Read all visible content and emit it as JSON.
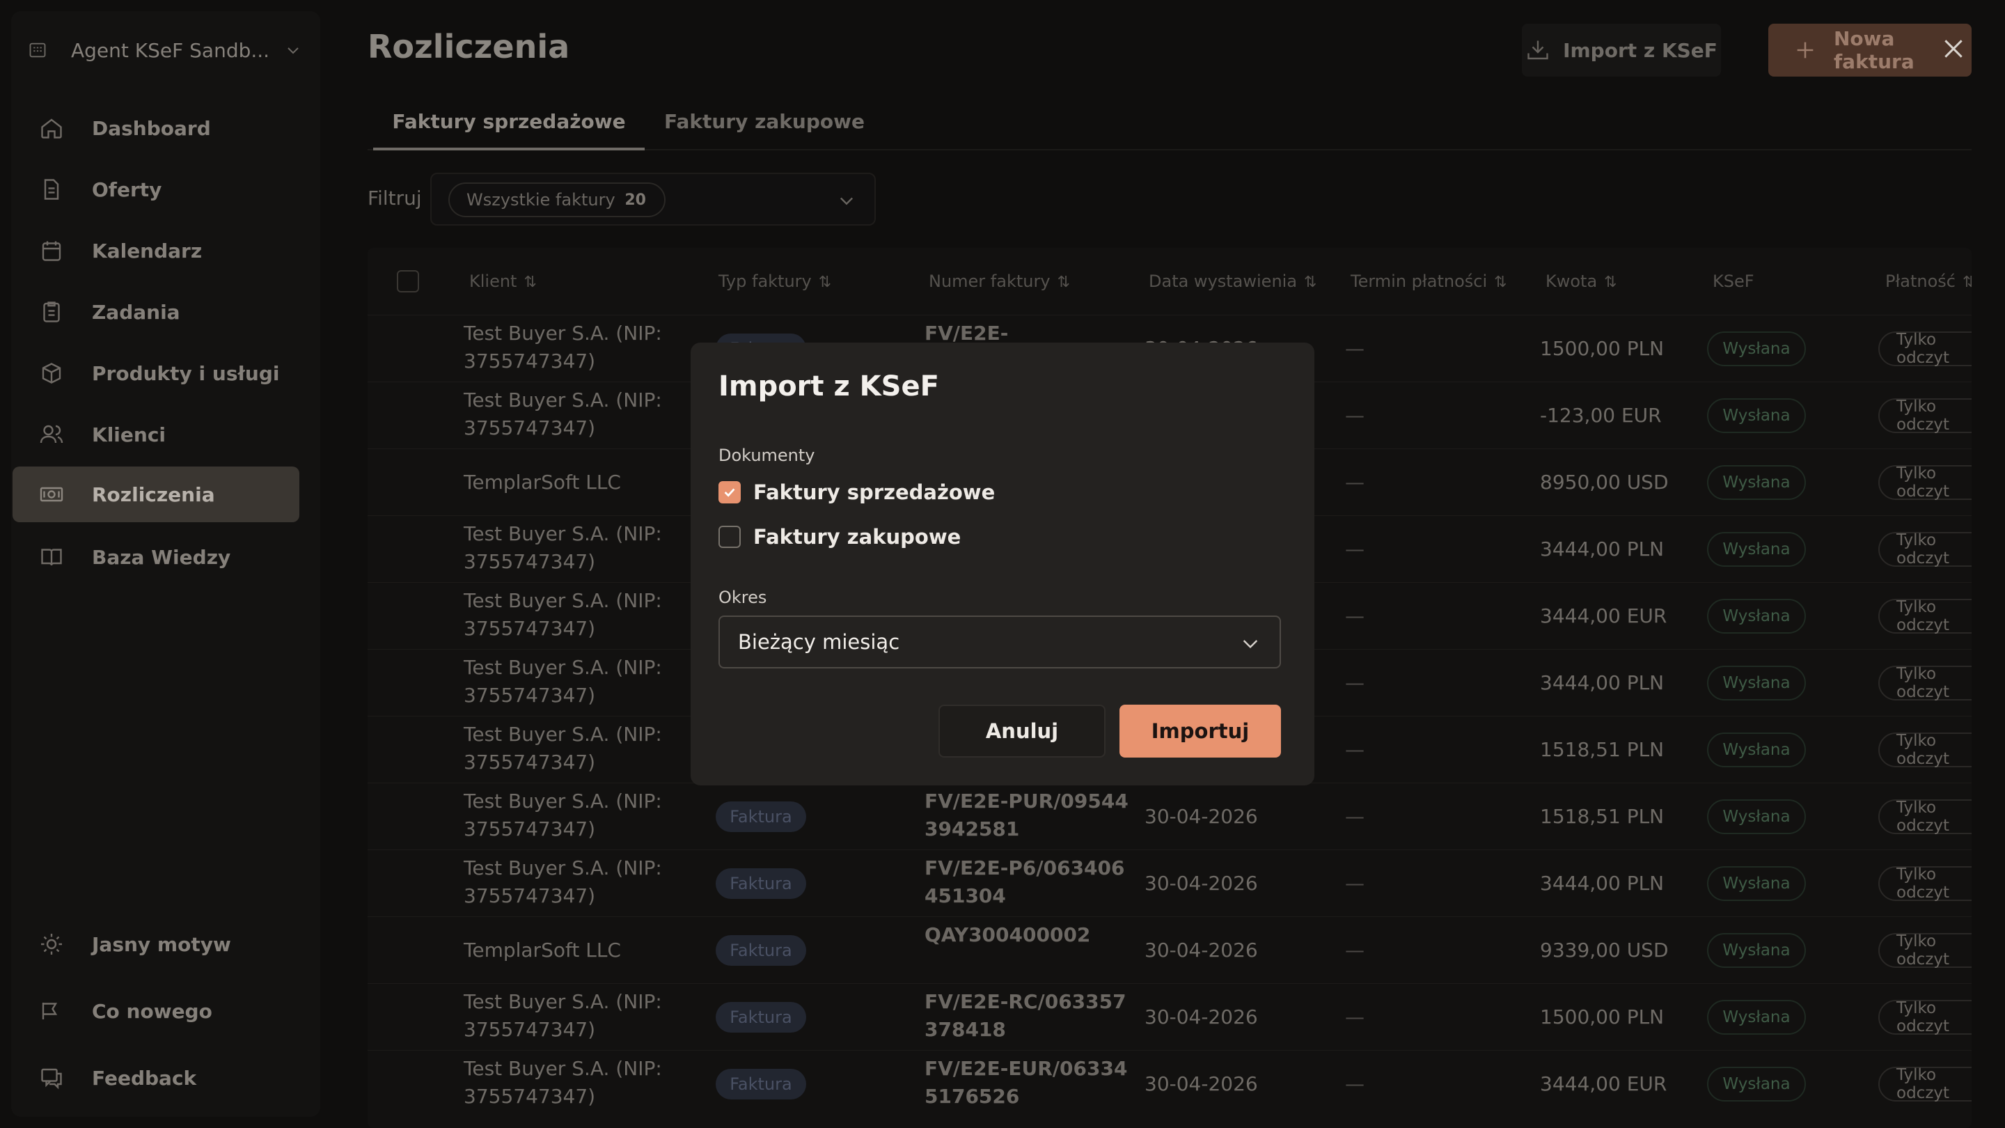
{
  "app": {
    "workspace": "Agent KSeF Sandb...",
    "page_title": "Rozliczenia"
  },
  "sidebar": {
    "items": [
      {
        "label": "Dashboard",
        "icon": "home-icon"
      },
      {
        "label": "Oferty",
        "icon": "document-icon"
      },
      {
        "label": "Kalendarz",
        "icon": "calendar-icon"
      },
      {
        "label": "Zadania",
        "icon": "clipboard-icon"
      },
      {
        "label": "Produkty i usługi",
        "icon": "box-icon"
      },
      {
        "label": "Klienci",
        "icon": "users-icon"
      },
      {
        "label": "Rozliczenia",
        "icon": "money-icon",
        "active": true
      },
      {
        "label": "Baza Wiedzy",
        "icon": "book-icon"
      }
    ],
    "bottom": [
      {
        "label": "Jasny motyw",
        "icon": "sun-icon"
      },
      {
        "label": "Co nowego",
        "icon": "megaphone-icon"
      },
      {
        "label": "Feedback",
        "icon": "feedback-icon"
      }
    ]
  },
  "header": {
    "import_label": "Import z KSeF",
    "new_label": "Nowa faktura"
  },
  "tabs": [
    "Faktury sprzedażowe",
    "Faktury zakupowe"
  ],
  "filter": {
    "label": "Filtruj",
    "chip_label": "Wszystkie faktury",
    "chip_count": "20"
  },
  "table": {
    "columns": [
      "Klient",
      "Typ faktury",
      "Numer faktury",
      "Data wystawienia",
      "Termin płatności",
      "Kwota",
      "KSeF",
      "Płatność"
    ],
    "rows": [
      {
        "client": "Test Buyer S.A. (NIP: 3755747347)",
        "type": "Faktura",
        "number": "FV/E2E-",
        "date": "30-04-2026",
        "term": "—",
        "amount": "1500,00 PLN",
        "ksef": "Wysłana",
        "payment": "Tylko odczyt"
      },
      {
        "client": "Test Buyer S.A. (NIP: 3755747347)",
        "type": "",
        "number": "",
        "date": "",
        "term": "—",
        "amount": "-123,00 EUR",
        "ksef": "Wysłana",
        "payment": "Tylko odczyt"
      },
      {
        "client": "TemplarSoft LLC",
        "type": "",
        "number": "",
        "date": "",
        "term": "—",
        "amount": "8950,00 USD",
        "ksef": "Wysłana",
        "payment": "Tylko odczyt"
      },
      {
        "client": "Test Buyer S.A. (NIP: 3755747347)",
        "type": "",
        "number": "",
        "date": "",
        "term": "—",
        "amount": "3444,00 PLN",
        "ksef": "Wysłana",
        "payment": "Tylko odczyt"
      },
      {
        "client": "Test Buyer S.A. (NIP: 3755747347)",
        "type": "",
        "number": "",
        "date": "",
        "term": "—",
        "amount": "3444,00 EUR",
        "ksef": "Wysłana",
        "payment": "Tylko odczyt"
      },
      {
        "client": "Test Buyer S.A. (NIP: 3755747347)",
        "type": "",
        "number": "",
        "date": "",
        "term": "—",
        "amount": "3444,00 PLN",
        "ksef": "Wysłana",
        "payment": "Tylko odczyt"
      },
      {
        "client": "Test Buyer S.A. (NIP: 3755747347)",
        "type": "",
        "number": "",
        "date": "",
        "term": "—",
        "amount": "1518,51 PLN",
        "ksef": "Wysłana",
        "payment": "Tylko odczyt"
      },
      {
        "client": "Test Buyer S.A. (NIP: 3755747347)",
        "type": "Faktura",
        "number": "FV/E2E-PUR/095443942581",
        "date": "30-04-2026",
        "term": "—",
        "amount": "1518,51 PLN",
        "ksef": "Wysłana",
        "payment": "Tylko odczyt"
      },
      {
        "client": "Test Buyer S.A. (NIP: 3755747347)",
        "type": "Faktura",
        "number": "FV/E2E-P6/063406451304",
        "date": "30-04-2026",
        "term": "—",
        "amount": "3444,00 PLN",
        "ksef": "Wysłana",
        "payment": "Tylko odczyt"
      },
      {
        "client": "TemplarSoft LLC",
        "type": "Faktura",
        "number": "QAY300400002",
        "date": "30-04-2026",
        "term": "—",
        "amount": "9339,00 USD",
        "ksef": "Wysłana",
        "payment": "Tylko odczyt"
      },
      {
        "client": "Test Buyer S.A. (NIP: 3755747347)",
        "type": "Faktura",
        "number": "FV/E2E-RC/063357378418",
        "date": "30-04-2026",
        "term": "—",
        "amount": "1500,00 PLN",
        "ksef": "Wysłana",
        "payment": "Tylko odczyt"
      },
      {
        "client": "Test Buyer S.A. (NIP: 3755747347)",
        "type": "Faktura",
        "number": "FV/E2E-EUR/063345176526",
        "date": "30-04-2026",
        "term": "—",
        "amount": "3444,00 EUR",
        "ksef": "Wysłana",
        "payment": "Tylko odczyt"
      }
    ]
  },
  "modal": {
    "title": "Import z KSeF",
    "documents_label": "Dokumenty",
    "options": [
      {
        "label": "Faktury sprzedażowe",
        "checked": true
      },
      {
        "label": "Faktury zakupowe",
        "checked": false
      }
    ],
    "period_label": "Okres",
    "period_value": "Bieżący miesiąc",
    "cancel_label": "Anuluj",
    "import_label": "Importuj"
  },
  "colors": {
    "accent": "#e8936f",
    "modal_bg": "#242220",
    "page_bg": "#0f0e0d"
  }
}
